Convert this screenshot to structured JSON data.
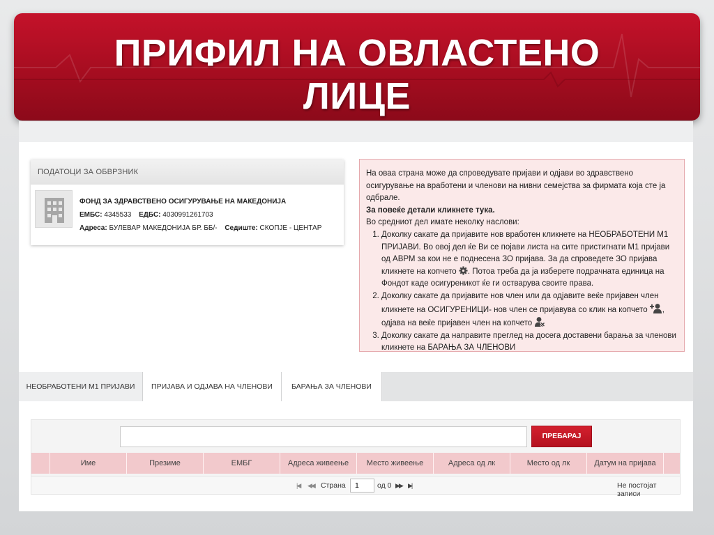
{
  "slide": {
    "title_line1": "ПРИФИЛ НА ОВЛАСТЕНО",
    "title_line2": "ЛИЦЕ"
  },
  "panel": {
    "header": "ПОДАТОЦИ ЗА ОБВРЗНИК",
    "firm_name": "ФОНД ЗА ЗДРАВСТВЕНО ОСИГУРУВАЊЕ НА МАКЕДОНИЈА",
    "embs_label": "ЕМБС:",
    "embs_value": "4345533",
    "edbs_label": "ЕДБС:",
    "edbs_value": "4030991261703",
    "address_label": "Адреса:",
    "address_value": "БУЛЕВАР МАКЕДОНИЈА БР. ББ/-",
    "seat_label": "Седиште:",
    "seat_value": "СКОПЈЕ - ЦЕНТАР"
  },
  "info": {
    "intro": "На оваа страна може да спроведувате пријави и одјави во здравствено осигурување на вработени и членови на нивни семејства за фирмата која сте ја одбрале.",
    "details_link": "За повеќе детали кликнете тука.",
    "subtitle": "Во средниот дел имате неколку наслови:",
    "item1_a": "Доколку сакате да пријавите нов вработен кликнете на НЕОБРАБОТЕНИ М1 ПРИЈАВИ. Во овој дел ќе Ви се појави листа на сите пристигнати М1 пријави од АВРМ за кои не е поднесена ЗО пријава. За да спроведете ЗО пријава кликнете на копчето",
    "item1_b": ". Потоа треба да ја изберете подрачната единица на Фондот каде осигуреникот ќе ги остварува своите права.",
    "item2_a": "Доколку сакате да пријавите нов член или да одјавите веќе пријавен член кликнете на ОСИГУРЕНИЦИ- нов член се пријавува со клик на копчето",
    "item2_b": ", одјава на веќе пријавен член на копчето",
    "item3": "Доколку сакате да направите преглед на досега доставени барања за членови кликнете на БАРАЊА ЗА ЧЛЕНОВИ"
  },
  "tabs": [
    {
      "label": "НЕОБРАБОТЕНИ М1 ПРИЈАВИ"
    },
    {
      "label": "ПРИЈАВА И ОДЈАВА НА ЧЛЕНОВИ"
    },
    {
      "label": "БАРАЊА ЗА ЧЛЕНОВИ"
    }
  ],
  "search": {
    "value": "",
    "button_label": "ПРЕБАРАЈ"
  },
  "table": {
    "columns": [
      "Име",
      "Презиме",
      "ЕМБГ",
      "Адреса живеење",
      "Место живеење",
      "Адреса од лк",
      "Место од лк",
      "Датум на пријава"
    ]
  },
  "pager": {
    "page_label": "Страна",
    "page_value": "1",
    "of_label": "од 0",
    "empty_text": "Не постојат записи"
  },
  "colors": {
    "brand_red": "#b4111f",
    "header_pink": "#f2c9cc",
    "info_bg": "#fbe9e9"
  },
  "icons": [
    "gear-icon",
    "add-user-icon",
    "remove-user-icon",
    "building-icon",
    "search-icon"
  ]
}
